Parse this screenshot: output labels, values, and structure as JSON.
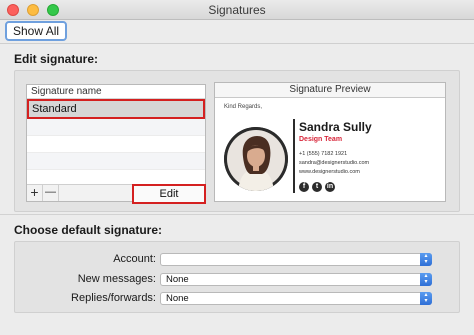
{
  "window": {
    "title": "Signatures"
  },
  "toolbar": {
    "show_all": "Show All"
  },
  "edit_section": {
    "title": "Edit signature:",
    "list_header": "Signature name",
    "selected_item": "Standard",
    "add_label": "+",
    "remove_label": "—",
    "edit_label": "Edit",
    "preview_header": "Signature Preview"
  },
  "preview": {
    "greeting": "Kind Regards,",
    "name": "Sandra Sully",
    "team": "Design Team",
    "phone": "+1 (555) 7182 1921",
    "email": "sandra@designerstudio.com",
    "website": "www.designerstudio.com",
    "social_icons": [
      "facebook-icon",
      "twitter-icon",
      "linkedin-icon"
    ],
    "accent_color": "#d8263a"
  },
  "default_section": {
    "title": "Choose default signature:",
    "account_label": "Account:",
    "account_value": "",
    "new_messages_label": "New messages:",
    "new_messages_value": "None",
    "replies_label": "Replies/forwards:",
    "replies_value": "None"
  }
}
